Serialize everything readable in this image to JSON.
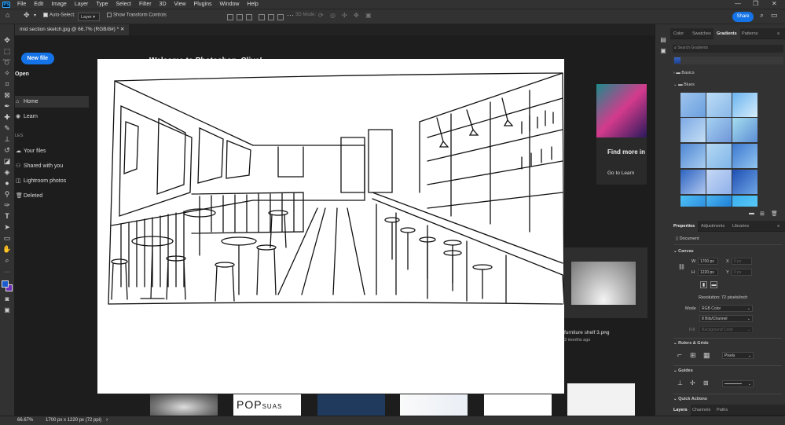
{
  "app": {
    "logo": "Ps"
  },
  "menu": [
    "File",
    "Edit",
    "Image",
    "Layer",
    "Type",
    "Select",
    "Filter",
    "3D",
    "View",
    "Plugins",
    "Window",
    "Help"
  ],
  "options": {
    "auto_select": "Auto-Select:",
    "layer_dropdown": "Layer",
    "show_transform": "Show Transform Controls",
    "mode_3d": "3D Mode:",
    "share": "Share"
  },
  "document_tab": "mid section sketch.jpg @ 66.7% (RGB/8#) *",
  "home": {
    "new_file": "New file",
    "open": "Open",
    "nav": [
      {
        "label": "Home",
        "icon": "home-icon"
      },
      {
        "label": "Learn",
        "icon": "learn-icon"
      }
    ],
    "files_header": "FILES",
    "files": [
      {
        "label": "Your files",
        "icon": "cloud-icon"
      },
      {
        "label": "Shared with you",
        "icon": "shared-icon"
      },
      {
        "label": "Lightroom photos",
        "icon": "lightroom-icon"
      },
      {
        "label": "Deleted",
        "icon": "trash-icon"
      }
    ],
    "welcome": "Welcome to Photoshop, Clive!",
    "find_more": "Find more in",
    "go_to_learn": "Go to Learn",
    "recent_name": "furniture shelf 3.png",
    "recent_time": "3 months ago",
    "thumb_pop": "POP",
    "thumb_suas": "SUAS"
  },
  "gradients_panel": {
    "tabs": [
      "Color",
      "Swatches",
      "Gradients",
      "Patterns"
    ],
    "active_tab": "Gradients",
    "search_placeholder": "Search Gradients",
    "groups": [
      "Basics",
      "Blues"
    ]
  },
  "properties_panel": {
    "tabs": [
      "Properties",
      "Adjustments",
      "Libraries"
    ],
    "active_tab": "Properties",
    "document_label": "Document",
    "canvas_header": "Canvas",
    "w_label": "W",
    "h_label": "H",
    "x_label": "X",
    "y_label": "Y",
    "width": "1700 px",
    "height": "1220 px",
    "x_val": "0 px",
    "y_val": "0 px",
    "resolution": "Resolution: 72 pixels/inch",
    "mode_label": "Mode",
    "mode_value": "RGB Color",
    "bits_value": "8 Bits/Channel",
    "fill_label": "Fill",
    "fill_value": "Background Color",
    "rulers_header": "Rulers & Grids",
    "units_value": "Pixels",
    "guides_header": "Guides",
    "quick_actions": "Quick Actions"
  },
  "bottom_tabs": [
    "Layers",
    "Channels",
    "Paths"
  ],
  "status": {
    "zoom": "66.67%",
    "doc_size": "1700 px x 1220 px (72 ppi)"
  },
  "colors": {
    "accent": "#1473e6",
    "foreground": "#1a5ccf",
    "background": "#6a2fb5"
  }
}
